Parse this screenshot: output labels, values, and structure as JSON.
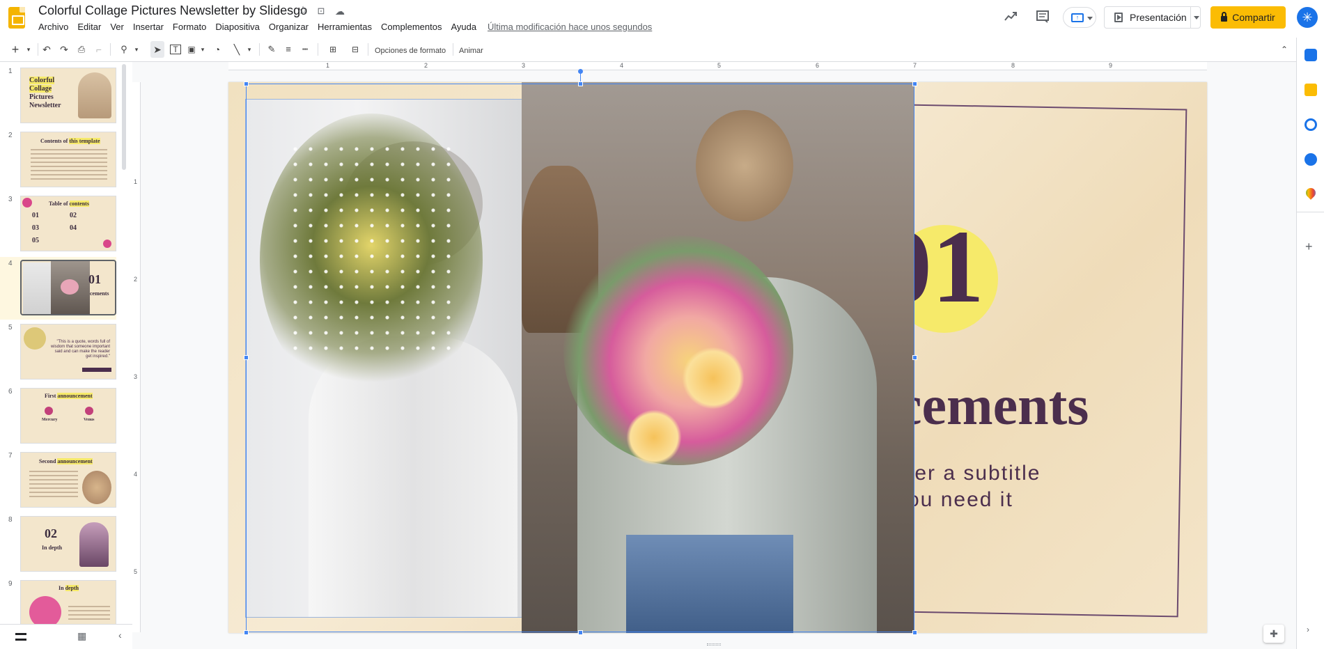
{
  "header": {
    "doc_title": "Colorful Collage Pictures Newsletter by Slidesgo",
    "menu": [
      "Archivo",
      "Editar",
      "Ver",
      "Insertar",
      "Formato",
      "Diapositiva",
      "Organizar",
      "Herramientas",
      "Complementos",
      "Ayuda"
    ],
    "last_edit": "Última modificación hace unos segundos",
    "present_label": "Presentación",
    "share_label": "Compartir",
    "avatar_letter": "✳"
  },
  "toolbar": {
    "format_options": "Opciones de formato",
    "animate": "Animar"
  },
  "ruler": {
    "h_numbers": [
      "1",
      "2",
      "3",
      "4",
      "5",
      "6",
      "7",
      "8",
      "9"
    ],
    "v_numbers": [
      "1",
      "2",
      "3",
      "4",
      "5"
    ]
  },
  "filmstrip": {
    "slides": [
      {
        "num": "1",
        "title_a": "Colorful",
        "title_b": "Collage",
        "title_c": "Pictures",
        "title_d": "Newsletter"
      },
      {
        "num": "2",
        "title": "Contents of",
        "hl": "this template"
      },
      {
        "num": "3",
        "title": "Table of",
        "hl": "contents",
        "items": [
          "01",
          "02",
          "03",
          "04",
          "05"
        ]
      },
      {
        "num": "4",
        "number": "01",
        "text": "cements"
      },
      {
        "num": "5",
        "quote": "\"This is a quote, words full of wisdom that someone important said and can make the reader get inspired.\""
      },
      {
        "num": "6",
        "title": "First",
        "hl": "announcement",
        "labels": [
          "Mercury",
          "Venus"
        ]
      },
      {
        "num": "7",
        "title": "Second",
        "hl": "announcement"
      },
      {
        "num": "8",
        "number": "02",
        "text": "In depth"
      },
      {
        "num": "9",
        "title": "In",
        "hl": "depth"
      }
    ]
  },
  "slide": {
    "number": "01",
    "title": "cements",
    "subtitle_line1": "ter a subtitle",
    "subtitle_line2": "ou need it"
  },
  "colors": {
    "accent_yellow": "#fbbc04",
    "selection_blue": "#4285f4",
    "slide_purple": "#4b2e4d",
    "highlight_yellow": "#f6ea6a",
    "slide_bg": "#f2e2c3"
  },
  "icons": {
    "star": "☆",
    "move": "⊡",
    "cloud": "☁",
    "trend": "📈",
    "comments": "▤"
  }
}
